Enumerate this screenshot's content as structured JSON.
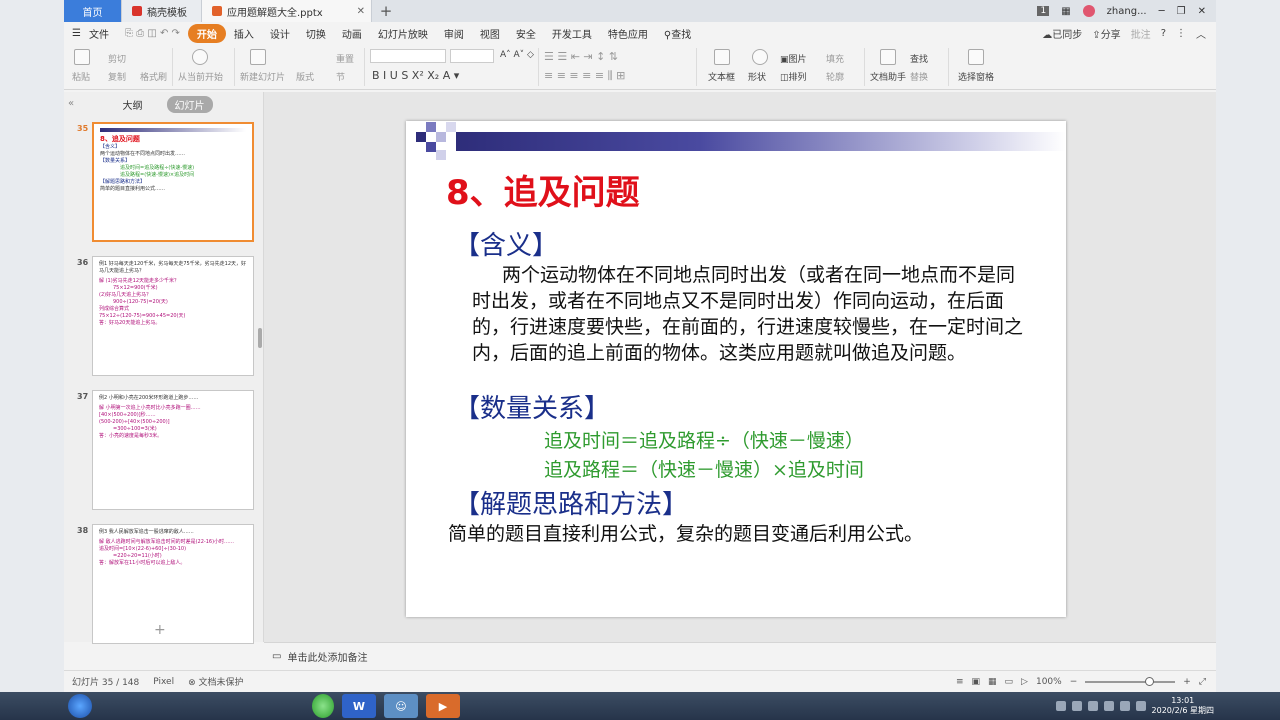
{
  "titlebar": {
    "home_tab": "首页",
    "tab1": "稿壳模板",
    "tab2": "应用题解题大全.pptx",
    "badge": "1",
    "user": "zhang..."
  },
  "menu": {
    "file": "文件",
    "items": [
      "开始",
      "插入",
      "设计",
      "切换",
      "动画",
      "幻灯片放映",
      "审阅",
      "视图",
      "安全",
      "开发工具",
      "特色应用"
    ],
    "search": "查找",
    "sync": "已同步",
    "share": "分享",
    "comment": "批注"
  },
  "ribbon": {
    "paste": "粘贴",
    "cut": "剪切",
    "copy": "复制",
    "format_painter": "格式刷",
    "from_start": "从当前开始",
    "new_slide": "新建幻灯片",
    "layout": "版式",
    "section": "节",
    "reset": "重置",
    "text_box": "文本框",
    "shape": "形状",
    "picture": "图片",
    "arrange": "排列",
    "fill": "填充",
    "outline": "轮廓",
    "find": "查找",
    "replace": "替换",
    "doc_helper": "文档助手",
    "select_pane": "选择窗格"
  },
  "panel": {
    "outline_tab": "大纲",
    "slides_tab": "幻灯片"
  },
  "thumbnails": [
    {
      "num": "35",
      "lines": [
        "8、追及问题",
        "【含义】",
        "两个运动物体在不同地点同时出发……",
        "【数量关系】",
        "追及时间=追及路程÷(快速-慢速)",
        "追及路程=(快速-慢速)×追及时间",
        "【解题思路和方法】",
        "简单的题目直接利用公式……"
      ]
    },
    {
      "num": "36",
      "lines": [
        "例1 好马每天走120千米，劣马每天走75千米，劣马先走12天，好马几天能追上劣马？",
        "解 (1)劣马先走12天能走多少千米？",
        "75×12=900(千米)",
        "(2)好马几天追上劣马？",
        "900÷(120-75)=20(天)",
        "列成综合算式",
        "75×12÷(120-75)=900÷45=20(天)",
        "答：好马20天能追上劣马。"
      ]
    },
    {
      "num": "37",
      "lines": [
        "例2 小明和小亮在200米环形跑道上跑步……",
        "解 小明第一次追上小亮时比小亮多跑一圈……",
        "[40×(500÷200)]秒……",
        "(500-200)÷[40×(500÷200)]",
        "=300÷100=3(米)",
        "答：小亮的速度是每秒3米。"
      ]
    },
    {
      "num": "38",
      "lines": [
        "例3 我人民解放军追击一股逃窜的敌人……",
        "解 敌人逃跑时间与解放军追击时间的时差是(22-16)小时……",
        "追及时间=[10×(22-6)+60]÷(30-10)",
        "=220÷20=11(小时)",
        "答：解放军在11小时后可以追上敌人。"
      ]
    }
  ],
  "slide": {
    "title": "8、追及问题",
    "sec1": "【含义】",
    "body1": "两个运动物体在不同地点同时出发（或者在同一地点而不是同时出发，或者在不同地点又不是同时出发）作同向运动，在后面的，行进速度要快些，在前面的，行进速度较慢些，在一定时间之内，后面的追上前面的物体。这类应用题就叫做追及问题。",
    "sec2": "【数量关系】",
    "formula1": "追及时间＝追及路程÷（快速－慢速）",
    "formula2": "追及路程＝（快速－慢速）×追及时间",
    "sec3": "【解题思路和方法】",
    "body3": "简单的题目直接利用公式，复杂的题目变通后利用公式。"
  },
  "notes": "单击此处添加备注",
  "status": {
    "slide_counter": "幻灯片 35 / 148",
    "theme": "Pixel",
    "protect": "文档未保护",
    "zoom": "100%"
  },
  "taskbar": {
    "time": "13:01",
    "date": "2020/2/6 星期四"
  }
}
